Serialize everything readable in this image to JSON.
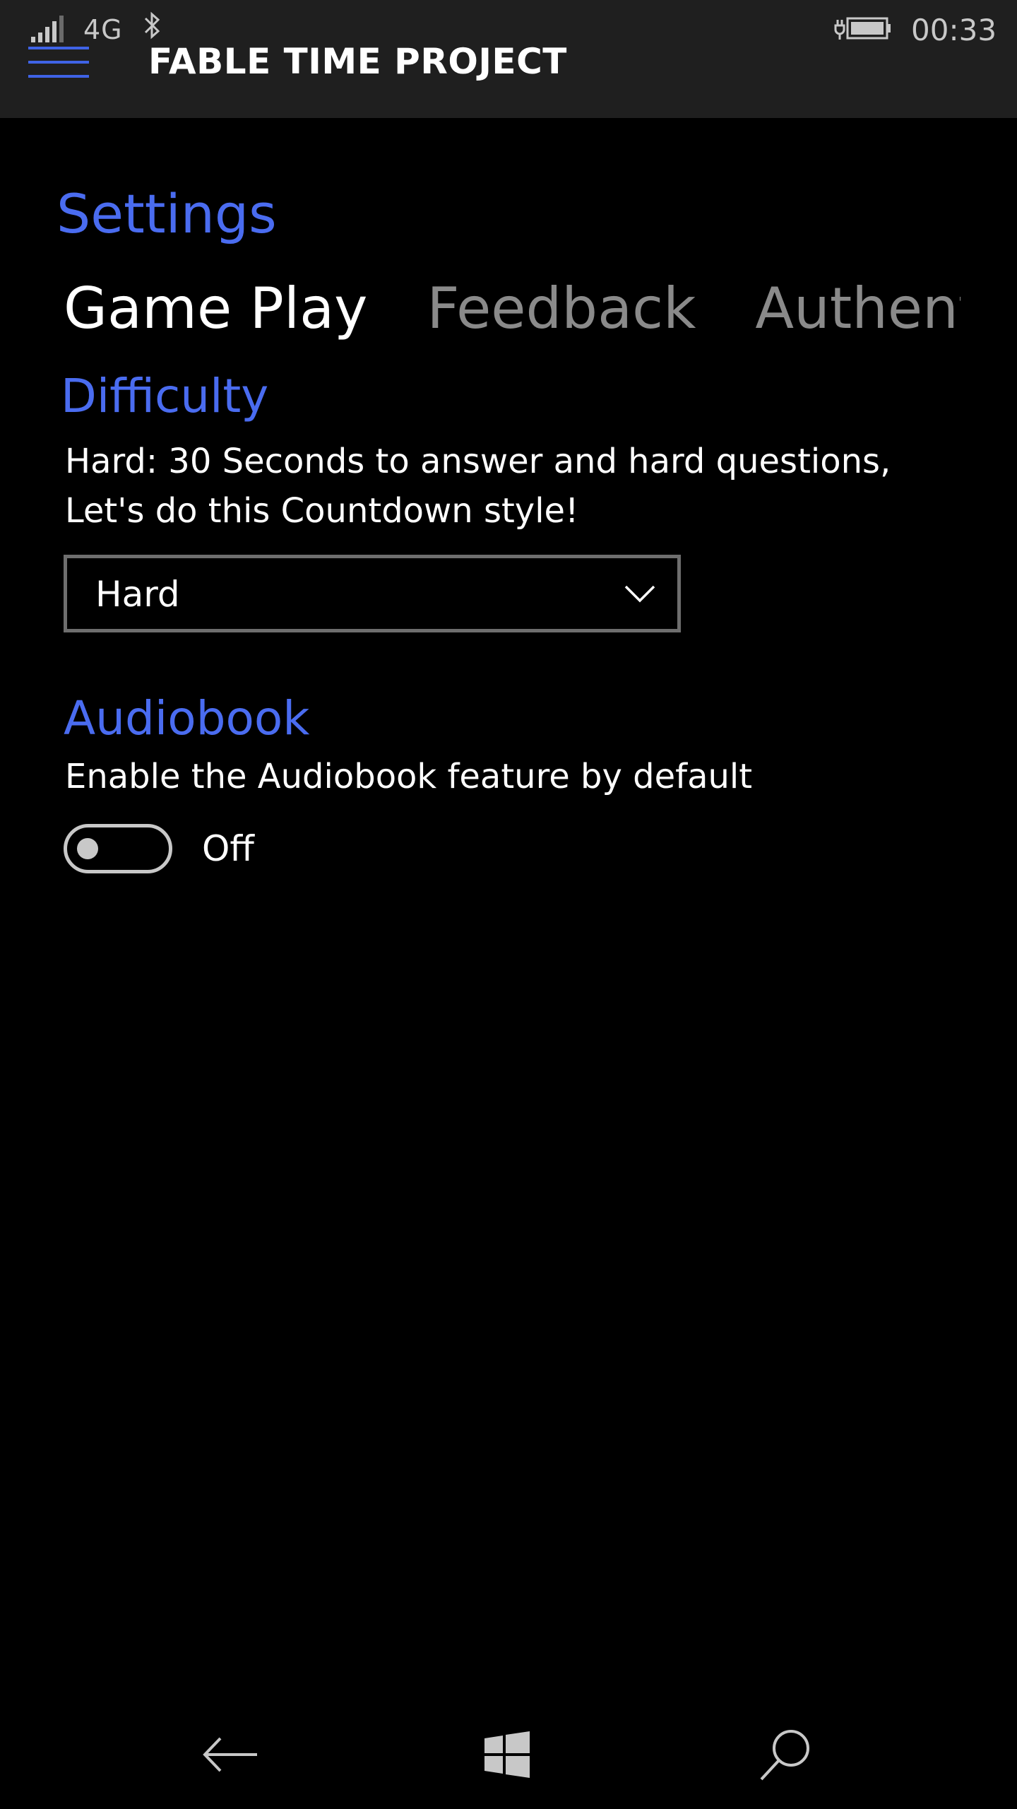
{
  "status_bar": {
    "network": "4G",
    "time": "00:33"
  },
  "app_bar": {
    "title": "FABLE TIME PROJECT"
  },
  "page": {
    "title": "Settings",
    "tabs": [
      {
        "label": "Game Play",
        "active": true
      },
      {
        "label": "Feedback",
        "active": false
      },
      {
        "label": "Authentica",
        "active": false
      }
    ]
  },
  "difficulty": {
    "heading": "Difficulty",
    "description_line1": "Hard: 30 Seconds to answer and hard questions,",
    "description_line2": "Let's do this Countdown style!",
    "selected": "Hard"
  },
  "audiobook": {
    "heading": "Audiobook",
    "description": "Enable the Audiobook feature by default",
    "toggle_state": "Off"
  },
  "colors": {
    "accent": "#4a6cf0",
    "hamburger": "#3f63e6",
    "app_bar_bg": "#1f1f1f",
    "background": "#000000",
    "inactive_tab": "#8a8a8a"
  },
  "icons": {
    "signal": "signal-bars-icon",
    "bluetooth": "bluetooth-icon",
    "battery": "battery-charging-icon",
    "menu": "hamburger-menu-icon",
    "dropdown": "chevron-down-icon",
    "back": "back-arrow-icon",
    "home": "windows-logo-icon",
    "search": "search-icon"
  }
}
